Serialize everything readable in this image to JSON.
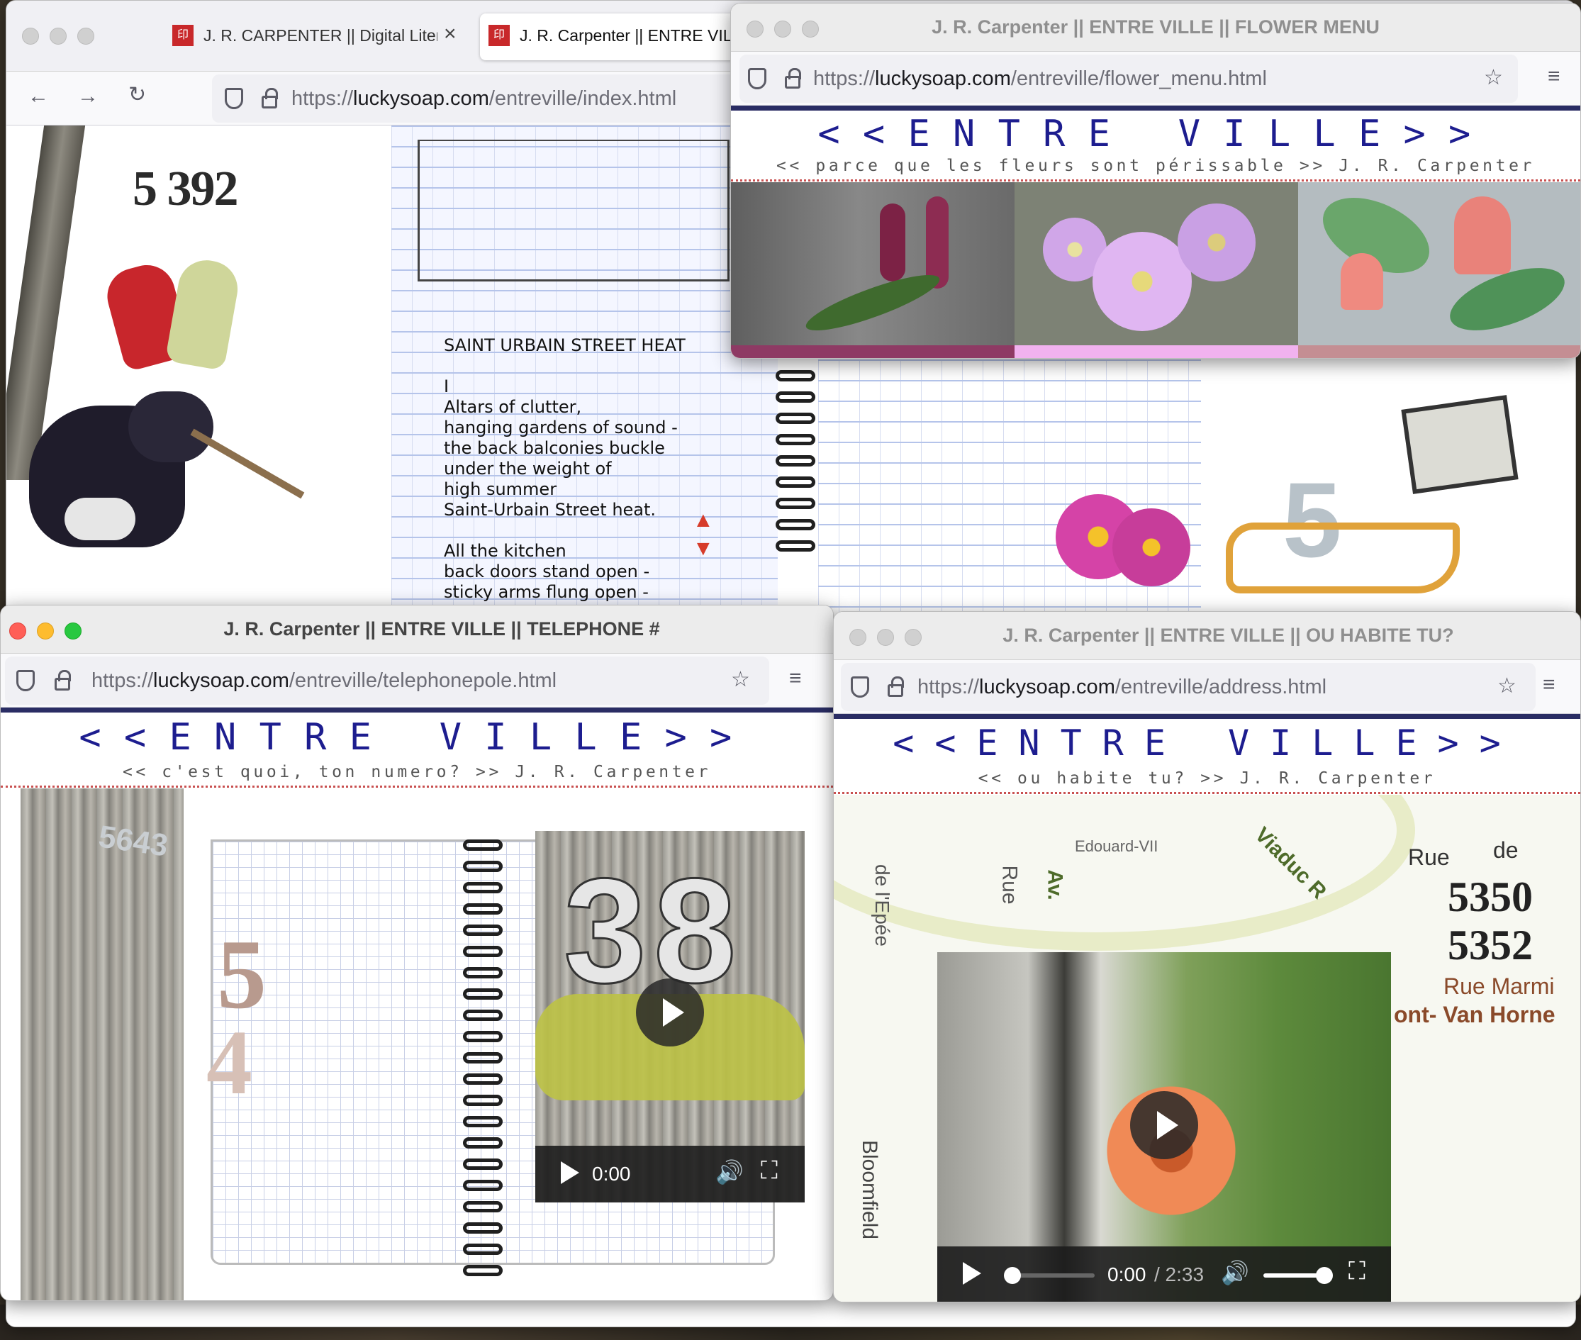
{
  "main_window": {
    "tabs": [
      {
        "label": "J. R. CARPENTER || Digital Litera",
        "favicon": "red-stamp-icon"
      },
      {
        "label": "J. R. Carpenter || ENTRE VILL",
        "favicon": "red-stamp-icon"
      }
    ],
    "url_base": "https://",
    "url_domain": "luckysoap.com",
    "url_path": "/entreville/index.html",
    "address_number": "5 392",
    "poem": {
      "title": "SAINT URBAIN STREET HEAT",
      "lines": [
        "I",
        "Altars of clutter,",
        "hanging gardens of sound -",
        "the back balconies buckle",
        "under the weight of",
        "high summer",
        "Saint-Urbain Street heat.",
        "",
        "All the kitchen",
        "back doors stand open -",
        "sticky arms flung open -"
      ]
    },
    "scroll_up": "▲",
    "scroll_down": "▼",
    "collage_number": "5"
  },
  "flower_window": {
    "title": "J. R. Carpenter || ENTRE VILLE || FLOWER MENU",
    "url_base": "https://",
    "url_domain": "luckysoap.com",
    "url_path": "/entreville/flower_menu.html",
    "logo": "<<ENTRE VILLE>>",
    "subtitle": "<< parce que les fleurs sont périssable >>  J. R. Carpenter",
    "bar_colors": [
      "#8e3a64",
      "#f1b2ef",
      "#c48e93"
    ]
  },
  "telephone_window": {
    "title": "J. R. Carpenter || ENTRE VILLE || TELEPHONE #",
    "url_base": "https://",
    "url_domain": "luckysoap.com",
    "url_path": "/entreville/telephonepole.html",
    "logo": "<<ENTRE VILLE>>",
    "subtitle": "<< c'est quoi, ton numero? >> J. R. Carpenter",
    "pole_number": "5643",
    "digits": [
      "5",
      "4"
    ],
    "video_digits": "38",
    "time": "0:00"
  },
  "address_window": {
    "title": "J. R. Carpenter || ENTRE VILLE || OU HABITE TU?",
    "url_base": "https://",
    "url_domain": "luckysoap.com",
    "url_path": "/entreville/address.html",
    "logo": "<<ENTRE VILLE>>",
    "subtitle": "<< ou habite tu? >> J. R. Carpenter",
    "map_labels": [
      "Rue",
      "de",
      "5350",
      "5352",
      "Rue Marmi",
      "ont- Van Horne",
      "Viaduc R",
      "Bloomfield",
      "Av.",
      "Rue",
      "de l'Epée",
      "Edouard-VII"
    ],
    "time_current": "0:00",
    "time_total": "/ 2:33",
    "progress_fraction": 0.0,
    "volume_fraction": 0.95
  }
}
